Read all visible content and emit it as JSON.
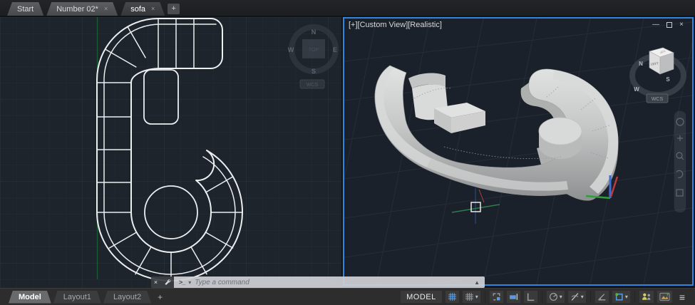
{
  "file_tabs": {
    "tabs": [
      {
        "label": "Start",
        "closable": false,
        "active": false
      },
      {
        "label": "Number 02*",
        "closable": true,
        "active": false
      },
      {
        "label": "sofa",
        "closable": true,
        "active": true
      }
    ],
    "close_glyph": "×",
    "new_tab_glyph": "+"
  },
  "viewport_3d": {
    "label": "[+][Custom View][Realistic]",
    "controls": {
      "minimize": "—",
      "close": "×"
    },
    "viewcube": {
      "face_front": "LEFT",
      "face_top": "TOP",
      "compass_n": "N",
      "compass_s": "S",
      "compass_w": "W",
      "wcs": "WCS"
    }
  },
  "viewport_2d": {
    "viewcube": {
      "face_top": "TOP",
      "compass_n": "N",
      "compass_s": "S",
      "compass_e": "E",
      "compass_w": "W",
      "wcs": "WCS"
    }
  },
  "command_line": {
    "close_glyph": "×",
    "prompt_glyph": ">_",
    "caret_glyph": "▾",
    "placeholder": "Type a command",
    "expand_glyph": "▲"
  },
  "layout_tabs": {
    "tabs": [
      {
        "label": "Model",
        "active": true
      },
      {
        "label": "Layout1",
        "active": false
      },
      {
        "label": "Layout2",
        "active": false
      }
    ],
    "new_tab_glyph": "+"
  },
  "status_bar": {
    "model_toggle": "MODEL",
    "caret_glyph": "▾",
    "menu_glyph": "≡",
    "icons": [
      "grid-display-icon",
      "grid-snap-icon",
      "infer-constraints-icon",
      "dynamic-input-icon",
      "ortho-mode-icon",
      "polar-tracking-icon",
      "isometric-drafting-icon",
      "annotation-monitor-icon",
      "object-snap-icon",
      "collaborate-icon",
      "hardware-acceleration-icon"
    ]
  },
  "colors": {
    "viewport_background": "#1e242c",
    "grid_line": "#232a33",
    "active_viewport_border": "#2e86e0",
    "drawing_line": "#eceef0",
    "axis_green": "#1d5e37",
    "ucs_x_red": "#c03a3a",
    "ucs_y_green": "#2f9e3f",
    "ucs_z_blue": "#3d6fd6",
    "model_3d_gray": "#c9cacb"
  }
}
